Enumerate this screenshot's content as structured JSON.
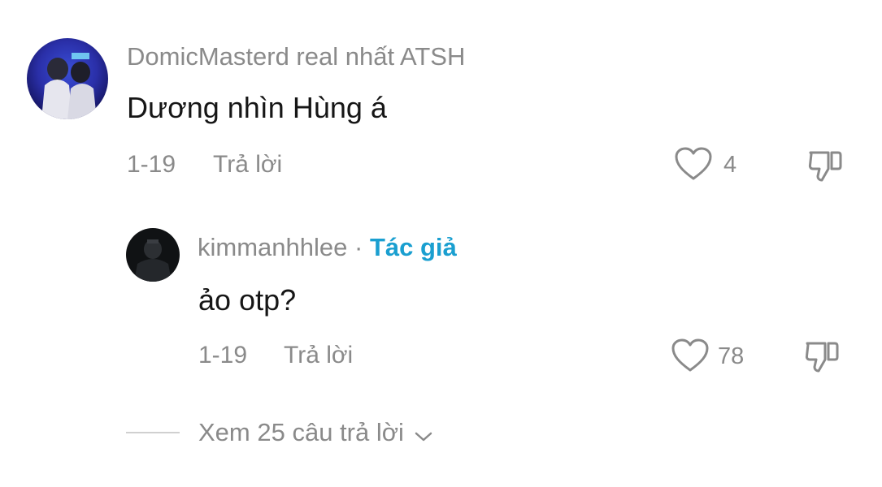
{
  "comments": [
    {
      "username": "DomicMasterd real nhất ATSH",
      "text": "Dương nhìn Hùng á",
      "date": "1-19",
      "reply_label": "Trả lời",
      "likes": "4",
      "icons": {
        "like": "heart-outline-icon",
        "dislike": "thumbs-down-icon"
      }
    }
  ],
  "replies": [
    {
      "username": "kimmanhhlee",
      "separator": "·",
      "author_label": "Tác giả",
      "author_color": "#1a9fd0",
      "text": "ảo otp?",
      "date": "1-19",
      "reply_label": "Trả lời",
      "likes": "78",
      "icons": {
        "like": "heart-outline-icon",
        "dislike": "thumbs-down-icon"
      }
    }
  ],
  "view_more": {
    "label": "Xem 25 câu trả lời",
    "icon": "chevron-down-icon"
  }
}
